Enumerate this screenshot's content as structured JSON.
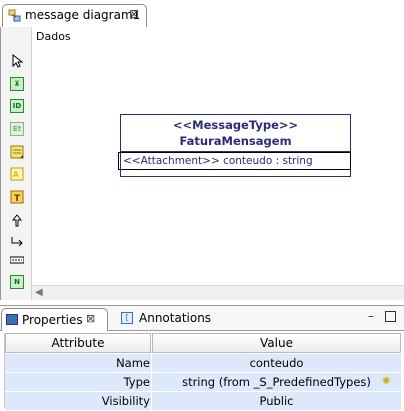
{
  "editor": {
    "tab_label": "message diagram1",
    "diagram_title": "Dados"
  },
  "palette": {
    "tools": [
      "select-tool",
      "message-type-tool",
      "id-tool",
      "attribute-tool",
      "note-tool",
      "annotation-tool",
      "text-tool",
      "generalization-tool",
      "association-tool",
      "link-tool",
      "ns-tool"
    ]
  },
  "class_box": {
    "stereotype": "<<MessageType>>",
    "name": "FaturaMensagem",
    "attribute": "<<Attachment>> conteudo : string"
  },
  "properties_view": {
    "tabs": [
      {
        "label": "Properties"
      },
      {
        "label": "Annotations"
      }
    ],
    "columns": [
      "Attribute",
      "Value"
    ],
    "rows": [
      {
        "key": "Name",
        "value": "conteudo"
      },
      {
        "key": "Type",
        "value": "string (from _S_PredefinedTypes)"
      },
      {
        "key": "Visibility",
        "value": "Public"
      }
    ]
  },
  "colors": {
    "class_text": "#2a2a7a",
    "row_highlight": "#dde9fb",
    "palette_green": "#2b8a2b"
  }
}
